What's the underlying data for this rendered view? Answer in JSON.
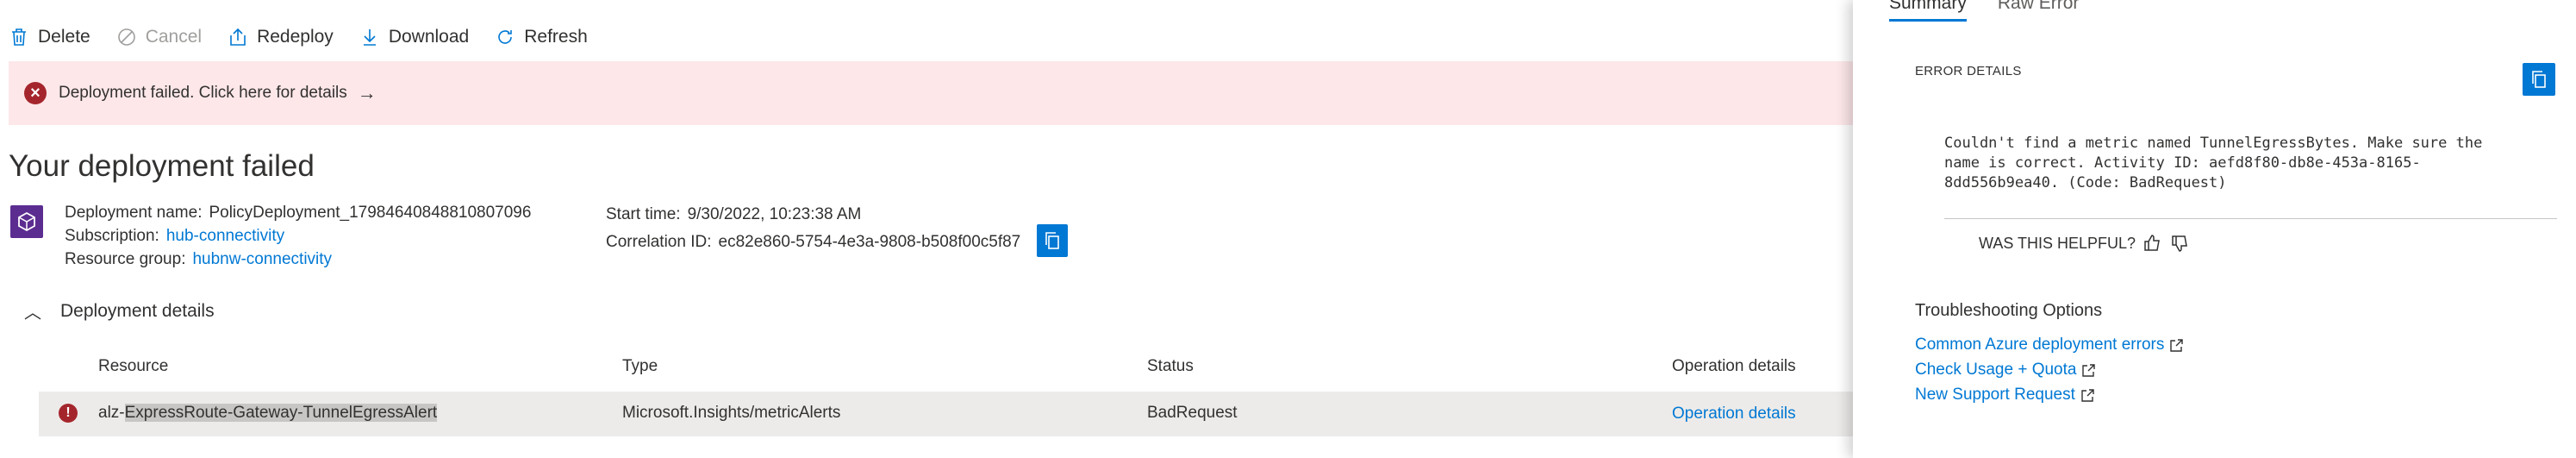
{
  "toolbar": {
    "delete": "Delete",
    "cancel": "Cancel",
    "redeploy": "Redeploy",
    "download": "Download",
    "refresh": "Refresh"
  },
  "banner": {
    "text": "Deployment failed. Click here for details",
    "arrow": "→"
  },
  "page_title": "Your deployment failed",
  "deployment": {
    "name_label": "Deployment name:",
    "name_value": "PolicyDeployment_17984640848810807096",
    "subscription_label": "Subscription:",
    "subscription_value": "hub-connectivity",
    "resource_group_label": "Resource group:",
    "resource_group_value": "hubnw-connectivity",
    "start_time_label": "Start time:",
    "start_time_value": "9/30/2022, 10:23:38 AM",
    "correlation_label": "Correlation ID:",
    "correlation_value": "ec82e860-5754-4e3a-9808-b508f00c5f87"
  },
  "details": {
    "heading": "Deployment details",
    "columns": [
      "Resource",
      "Type",
      "Status",
      "Operation details"
    ],
    "rows": [
      {
        "resource_prefix": "alz-",
        "resource_highlight": "ExpressRoute-Gateway-TunnelEgressAlert",
        "type": "Microsoft.Insights/metricAlerts",
        "status": "BadRequest",
        "operation": "Operation details"
      }
    ]
  },
  "panel": {
    "tabs": [
      {
        "label": "Summary",
        "active": true
      },
      {
        "label": "Raw Error",
        "active": false
      }
    ],
    "error_details_label": "ERROR DETAILS",
    "error_message": "Couldn't find a metric named TunnelEgressBytes. Make sure the\nname is correct. Activity ID: aefd8f80-db8e-453a-8165-\n8dd556b9ea40. (Code: BadRequest)",
    "helpful_text": "WAS THIS HELPFUL?",
    "troubleshooting_heading": "Troubleshooting Options",
    "links": [
      "Common Azure deployment errors",
      "Check Usage + Quota",
      "New Support Request"
    ]
  },
  "colors": {
    "accent": "#0078d4",
    "error": "#a4262c",
    "banner_bg": "#fde7e9",
    "deployment_icon_bg": "#5c2d91"
  }
}
